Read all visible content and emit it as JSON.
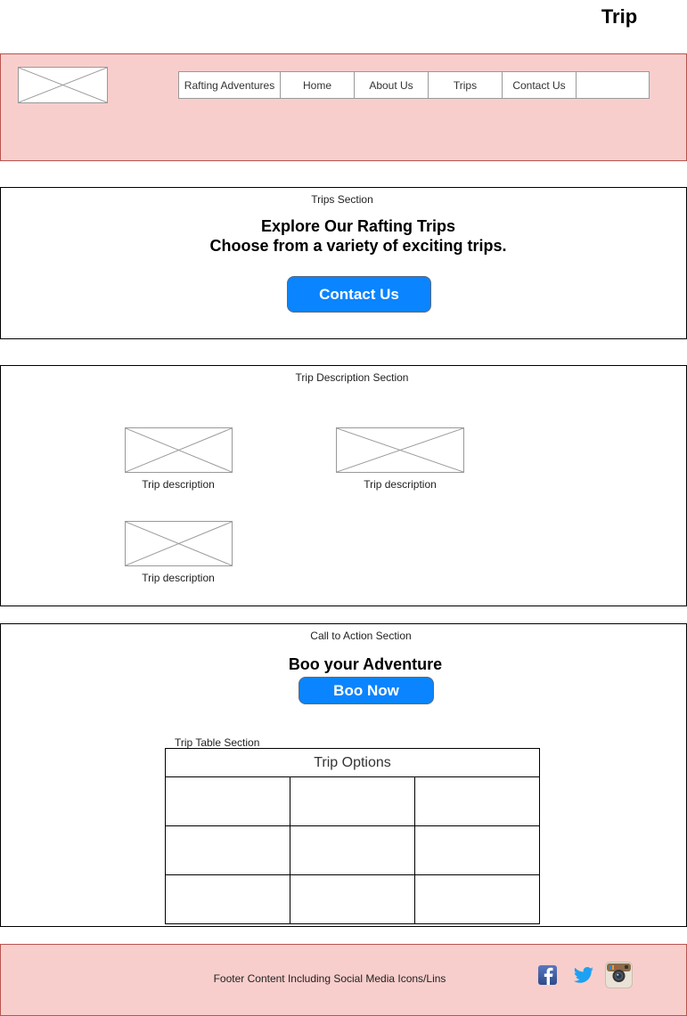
{
  "page": {
    "title": "Trip"
  },
  "header": {
    "logo_icon": "image-placeholder-icon",
    "nav": {
      "items": [
        {
          "label": "Rafting Adventures"
        },
        {
          "label": "Home"
        },
        {
          "label": "About Us"
        },
        {
          "label": "Trips"
        },
        {
          "label": "Contact Us"
        },
        {
          "label": ""
        }
      ]
    },
    "colors": {
      "fill": "#f8cecc",
      "border": "#b85450"
    }
  },
  "trips_section": {
    "label": "Trips Section",
    "heading_line1": "Explore Our Rafting Trips",
    "heading_line2": "Choose from a variety of exciting trips.",
    "button_label": "Contact Us",
    "button_color": "#0a84ff"
  },
  "description_section": {
    "label": "Trip Description Section",
    "trips": [
      {
        "caption": "Trip description",
        "image_icon": "image-placeholder-icon"
      },
      {
        "caption": "Trip description",
        "image_icon": "image-placeholder-icon"
      },
      {
        "caption": "Trip description",
        "image_icon": "image-placeholder-icon"
      }
    ]
  },
  "cta_section": {
    "label": "Call to Action Section",
    "heading": "Boo your Adventure",
    "button_label": "Boo Now",
    "table_label": "Trip Table Section",
    "table": {
      "header": "Trip Options",
      "rows": [
        [
          "",
          "",
          ""
        ],
        [
          "",
          "",
          ""
        ],
        [
          "",
          "",
          ""
        ]
      ]
    }
  },
  "footer": {
    "text": "Footer Content Including Social Media Icons/Lins",
    "icons": [
      "facebook-icon",
      "twitter-icon",
      "instagram-icon"
    ]
  }
}
